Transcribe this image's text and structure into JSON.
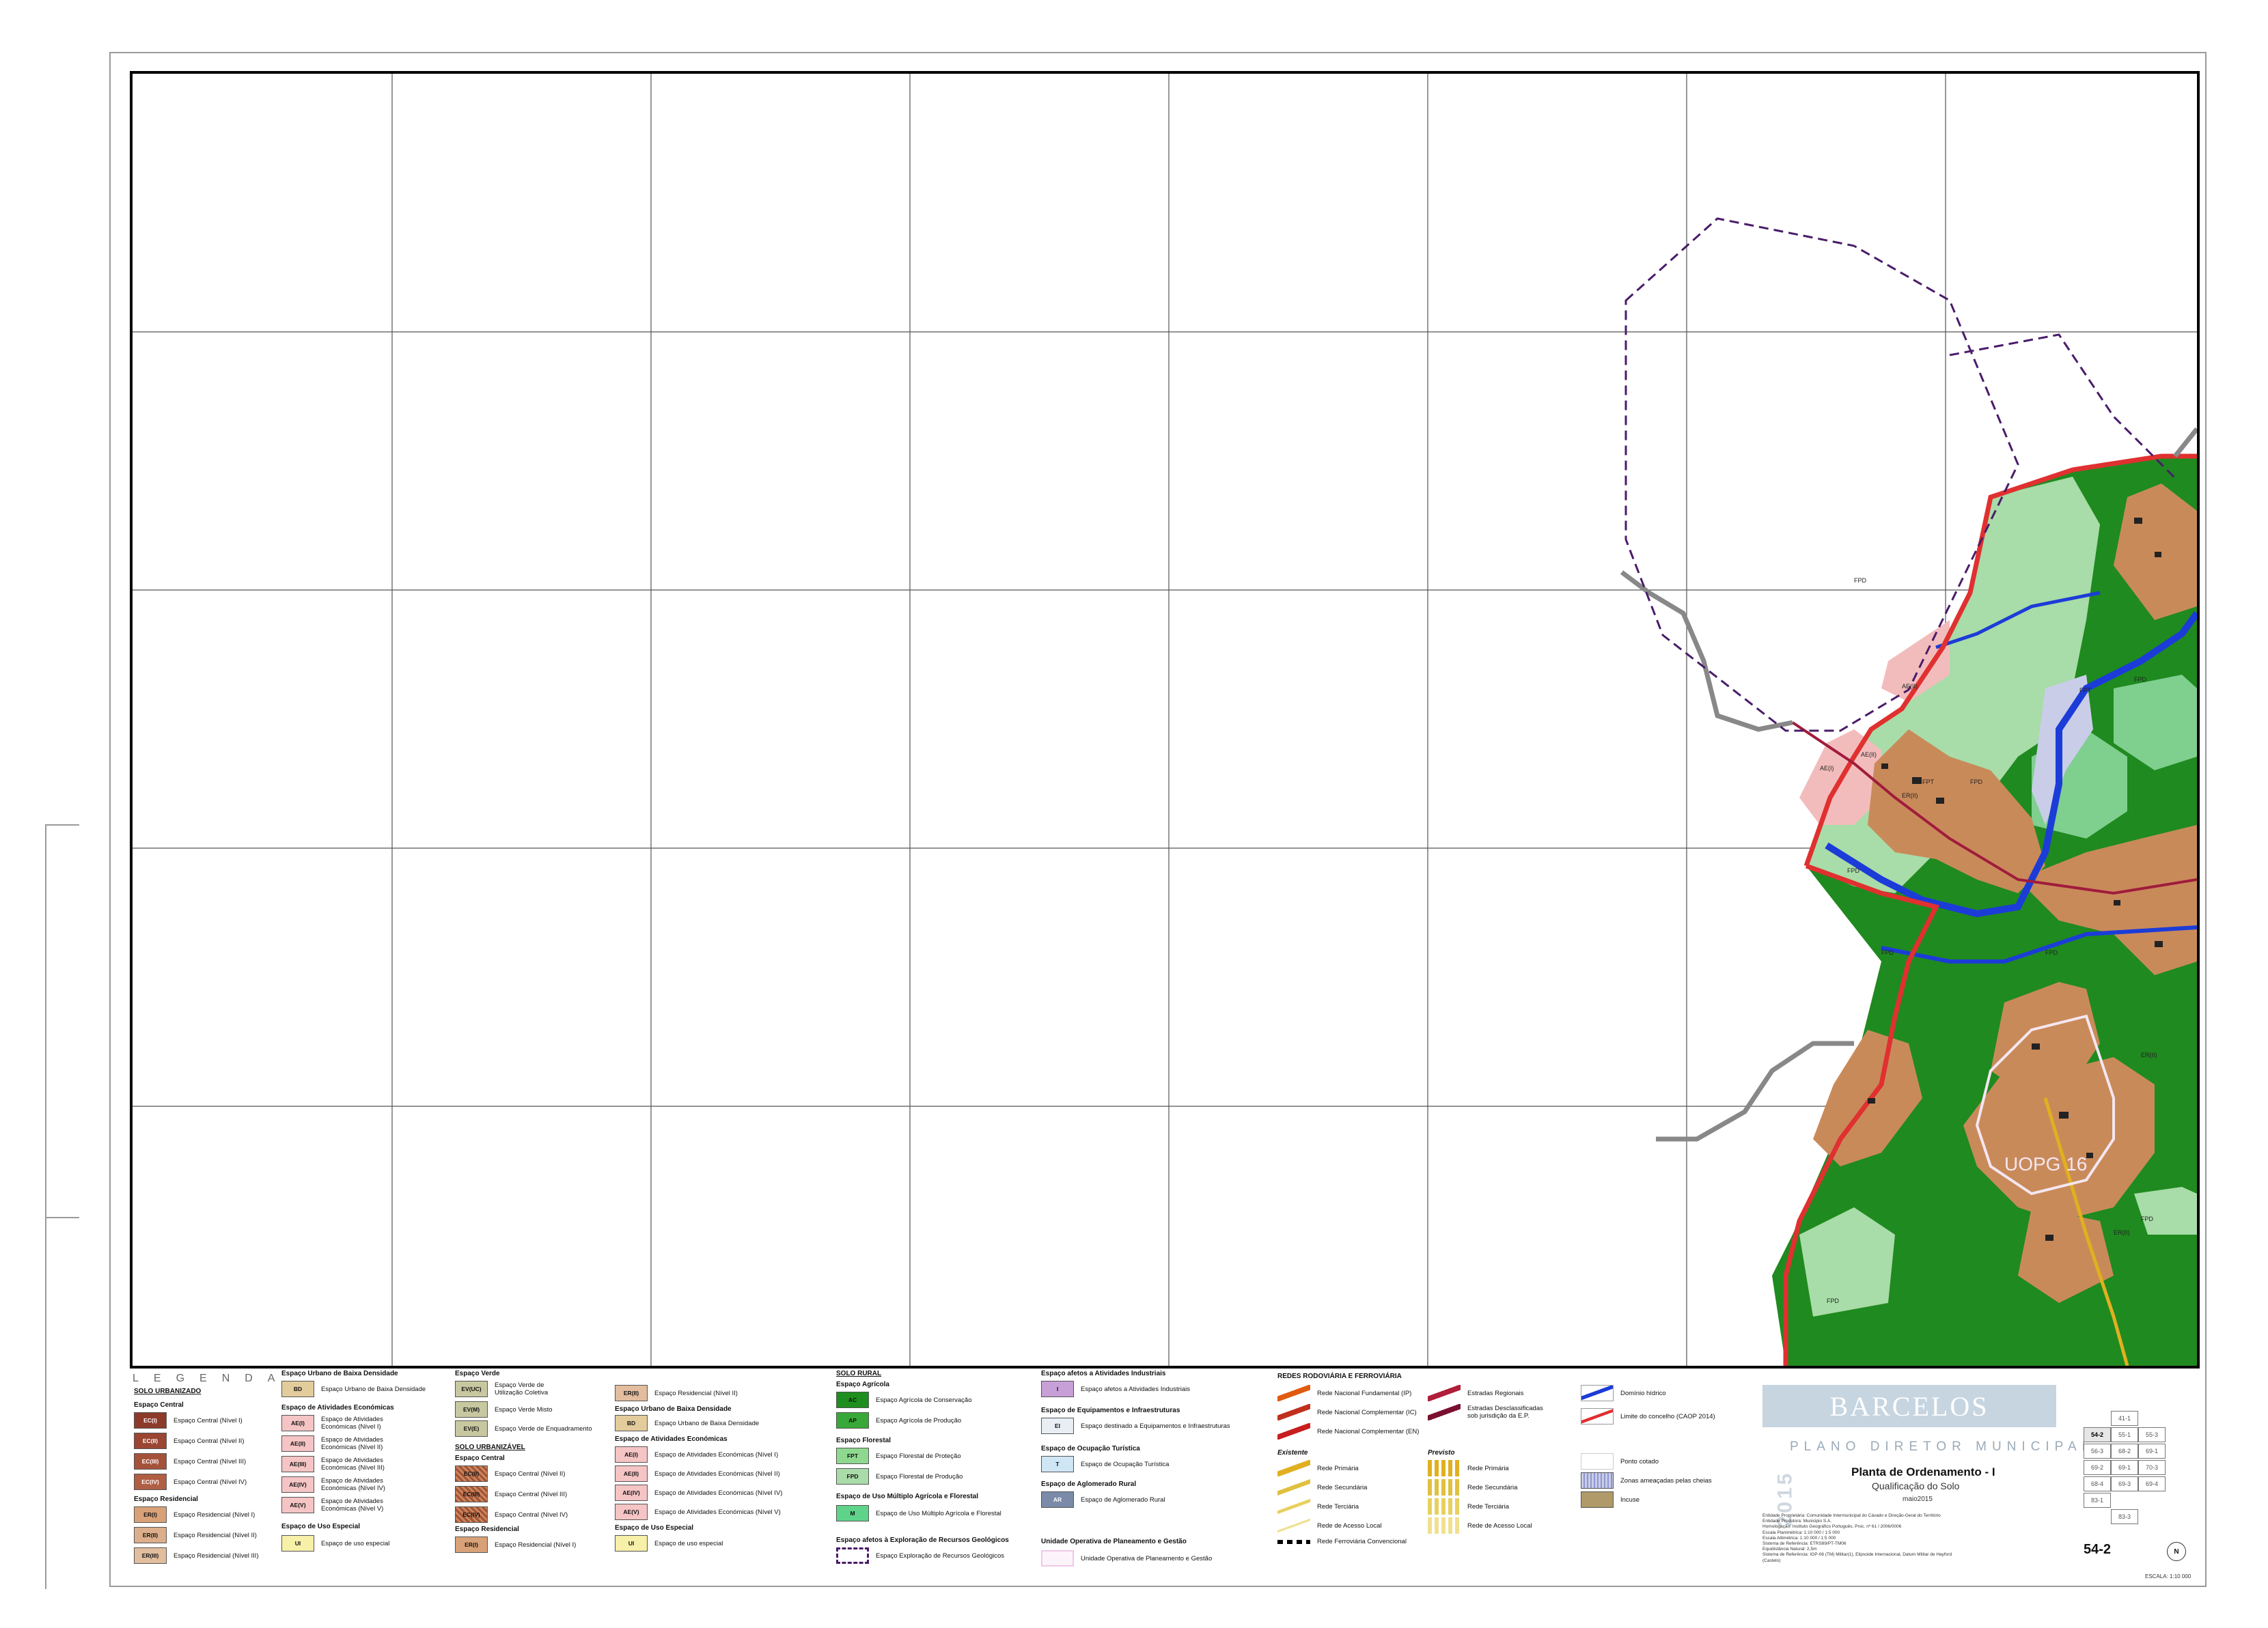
{
  "legend": {
    "word": "LEGENDA",
    "solo_urbanizado": "SOLO URBANIZADO",
    "espaco_central": "Espaço Central",
    "central_items": [
      {
        "code": "EC(I)",
        "label": "Espaço Central (Nível I)",
        "color": "#8c3a2a"
      },
      {
        "code": "EC(II)",
        "label": "Espaço Central (Nível II)",
        "color": "#9a4632"
      },
      {
        "code": "EC(III)",
        "label": "Espaço Central (Nível III)",
        "color": "#a5523b"
      },
      {
        "code": "EC(IV)",
        "label": "Espaço Central (Nível IV)",
        "color": "#b05e44"
      }
    ],
    "espaco_residencial": "Espaço Residencial",
    "res_items": [
      {
        "code": "ER(I)",
        "label": "Espaço Residencial (Nível I)",
        "color": "#d9a178"
      },
      {
        "code": "ER(II)",
        "label": "Espaço Residencial (Nível II)",
        "color": "#dcae8b"
      },
      {
        "code": "ER(III)",
        "label": "Espaço Residencial (Nível III)",
        "color": "#e2bd9e"
      }
    ],
    "baixa_densidade_group": "Espaço Urbano de Baixa Densidade",
    "bd_item": {
      "code": "BD",
      "label": "Espaço Urbano de Baixa Densidade",
      "color": "#e3cc9c"
    },
    "ae_group": "Espaço de Atividades Económicas",
    "ae_items": [
      {
        "code": "AE(I)",
        "label": "Espaço de Atividades Económicas (Nível I)",
        "color": "#f5c4c4"
      },
      {
        "code": "AE(II)",
        "label": "Espaço de Atividades Económicas (Nível II)",
        "color": "#f5c4c4"
      },
      {
        "code": "AE(III)",
        "label": "Espaço de Atividades Económicas (Nível III)",
        "color": "#f5c4c4"
      },
      {
        "code": "AE(IV)",
        "label": "Espaço de Atividades Económicas (Nível IV)",
        "color": "#f5c4c4"
      },
      {
        "code": "AE(V)",
        "label": "Espaço de Atividades Económicas (Nível V)",
        "color": "#f5c4c4"
      }
    ],
    "uso_especial_group": "Espaço de Uso Especial",
    "ue_item": {
      "code": "UI",
      "label": "Espaço de uso especial",
      "color": "#f7f0a8"
    },
    "verde_group": "Espaço Verde",
    "verde_items": [
      {
        "code": "EV(UC)",
        "label": "Espaço Verde de Utilização Coletiva",
        "color": "#c8c8a0"
      },
      {
        "code": "EV(M)",
        "label": "Espaço Verde Misto",
        "color": "#c8c8a0"
      },
      {
        "code": "EV(E)",
        "label": "Espaço Verde de Enquadramento",
        "color": "#c8c8a0"
      }
    ],
    "solo_urbanizavel": "SOLO URBANIZÁVEL",
    "urbanizavel_central": "Espaço Central",
    "urb_central_items": [
      {
        "code": "EC(II)",
        "label": "Espaço Central (Nível II)",
        "color": "#a5523b"
      },
      {
        "code": "EC(III)",
        "label": "Espaço Central (Nível III)",
        "color": "#a5523b"
      },
      {
        "code": "EC(IV)",
        "label": "Espaço Central (Nível IV)",
        "color": "#a5523b"
      }
    ],
    "urbanizavel_residencial": "Espaço Residencial",
    "urb_res_item": {
      "code": "ER(I)",
      "label": "Espaço Residencial (Nível I)",
      "color": "#d9a178"
    },
    "col4_res_item": {
      "code": "ER(II)",
      "label": "Espaço Residencial (Nível II)",
      "color": "#e2bd9e"
    },
    "col4_bd_group": "Espaço Urbano de Baixa Densidade",
    "col4_bd_item": {
      "code": "BD",
      "label": "Espaço Urbano de Baixa Densidade",
      "color": "#e3cc9c"
    },
    "col4_ae_group": "Espaço de Atividades Económicas",
    "col4_ae_items": [
      {
        "code": "AE(I)",
        "label": "Espaço de Atividades Económicas (Nível I)",
        "color": "#f5c4c4"
      },
      {
        "code": "AE(II)",
        "label": "Espaço de Atividades Económicas (Nível II)",
        "color": "#f5c4c4"
      },
      {
        "code": "AE(IV)",
        "label": "Espaço de Atividades Económicas (Nível IV)",
        "color": "#f5c4c4"
      },
      {
        "code": "AE(V)",
        "label": "Espaço de Atividades Económicas (Nível V)",
        "color": "#f5c4c4"
      }
    ],
    "col4_ue_group": "Espaço de Uso Especial",
    "col4_ue_item": {
      "code": "UI",
      "label": "Espaço de uso especial",
      "color": "#f7f0a8"
    },
    "solo_rural": "SOLO RURAL",
    "agricola_group": "Espaço Agrícola",
    "agricola_items": [
      {
        "code": "AC",
        "label": "Espaço Agrícola de Conservação",
        "color": "#1e8f1e"
      },
      {
        "code": "AP",
        "label": "Espaço Agrícola de Produção",
        "color": "#38a838"
      }
    ],
    "florestal_group": "Espaço Florestal",
    "florestal_items": [
      {
        "code": "FPT",
        "label": "Espaço Florestal de Proteção",
        "color": "#8fd88f"
      },
      {
        "code": "FPD",
        "label": "Espaço Florestal de Produção",
        "color": "#a9dca9"
      }
    ],
    "multiplo_group": "Espaço de Uso Múltiplo Agrícola e Florestal",
    "multiplo_item": {
      "code": "M",
      "label": "Espaço de Uso Múltiplo Agrícola e Florestal",
      "color": "#5fd38a"
    },
    "geologicos_group": "Espaço afetos à Exploração de Recursos Geológicos",
    "geologicos_item": {
      "label": "Espaço Exploração de Recursos Geológicos"
    },
    "industriais_group": "Espaço afetos a Atividades Industriais",
    "industriais_item": {
      "code": "I",
      "label": "Espaço afetos a Atividades Industriais",
      "color": "#c8a0d8"
    },
    "equip_group": "Espaço de Equipamentos e Infraestruturas",
    "equip_item": {
      "code": "EI",
      "label": "Espaço destinado a Equipamentos e Infraestruturas",
      "color": "#e8eef4"
    },
    "turistica_group": "Espaço de Ocupação Turística",
    "turistica_item": {
      "code": "T",
      "label": "Espaço de Ocupação Turística",
      "color": "#cfe6f5"
    },
    "aglomerado_group": "Espaço de Aglomerado Rural",
    "aglomerado_item": {
      "code": "AR",
      "label": "Espaço de Aglomerado Rural",
      "color": "#7a8aa8"
    },
    "uopg_group": "Unidade Operativa de Planeamento e Gestão",
    "uopg_item": {
      "label": "Unidade Operativa de Planeamento e Gestão"
    },
    "redes_head": "REDES RODOVIÁRIA E FERROVIÁRIA",
    "redes_items": [
      {
        "label": "Rede Nacional Fundamental (IP)",
        "color": "#e05a10"
      },
      {
        "label": "Rede Nacional Complementar (IC)",
        "color": "#c0301c"
      },
      {
        "label": "Rede Nacional Complementar (EN)",
        "color": "#c81e1e"
      }
    ],
    "redes_items_right": [
      {
        "label": "Estradas Regionais",
        "color": "#b01e3a"
      },
      {
        "label": "Estradas Desclassificadas sob jurisdição da E.P.",
        "color": "#7a1030"
      }
    ],
    "existente": "Existente",
    "previsto": "Previsto",
    "exist_items": [
      "Rede Primária",
      "Rede Secundária",
      "Rede Terciária",
      "Rede de Acesso Local"
    ],
    "prev_items": [
      "Rede Primária",
      "Rede Secundária",
      "Rede Terciária",
      "Rede de Acesso Local"
    ],
    "ferroviaria": "Rede Ferroviária Convencional",
    "misc_items": [
      "Domínio hídrico",
      "Limite do concelho (CAOP 2014)",
      "Ponto cotado",
      "Zonas ameaçadas pelas cheias",
      "Incuse"
    ]
  },
  "title_block": {
    "brand": "BARCELOS",
    "year": "2015",
    "pdm": "PLANO DIRETOR MUNICIPAL",
    "title": "Planta de Ordenamento - I",
    "subtitle": "Qualificação do Solo",
    "date": "maio2015",
    "meta_lines": [
      "Entidade Proprietária: Comunidade Intermunicipal do Cávado e Direção-Geral do Território",
      "Entidade Produtora: Municipio S.A.",
      "Homologação: Instituto Geográfico Português, Proc. nº 61 / 2006/0006",
      "Escala Planimétrica: 1:10 000 / 1:5 000",
      "Escala Altimétrica: 1:10 000 / 1:5 000",
      "Sistema de Referência: ETRS89/PT-TM06",
      "Equidistância Natural: 2,5m",
      "Sistema de Referência: IGP-06 (TM) Militar(1), Elipsoide Internacional, Datum Militar de Hayford (Castelo)"
    ],
    "sheet": "54-2",
    "scale": "ESCALA: 1:10 000",
    "north": "N",
    "index_cells": [
      "41-1",
      "54-2",
      "55-1",
      "55-3",
      "56-3",
      "68-2",
      "69-1",
      "69-2",
      "69-1",
      "70-3",
      "68-4",
      "69-3",
      "69-4",
      "83-1",
      "83-3"
    ]
  },
  "map_labels": {
    "uopg": "UOPG 16",
    "zones": [
      "FPD",
      "FPD",
      "FPT",
      "FPT",
      "FPD",
      "FPD",
      "AE(II)",
      "AE(I)",
      "AE(II)",
      "ER(II)",
      "FPD",
      "FPD",
      "FPD",
      "FPD",
      "ER(II)",
      "ER(II)"
    ]
  },
  "colors": {
    "forest_dark": "#1f8a1f",
    "forest_light": "#a8dca8",
    "forest_mid": "#7fcf8f",
    "residential": "#c98a5a",
    "activity": "#f3bcbc",
    "water": "#1c3cd8",
    "flood": "#c9cde8",
    "limit": "#e03030",
    "road_grey": "#888888",
    "quarry": "#4a1c6a"
  }
}
